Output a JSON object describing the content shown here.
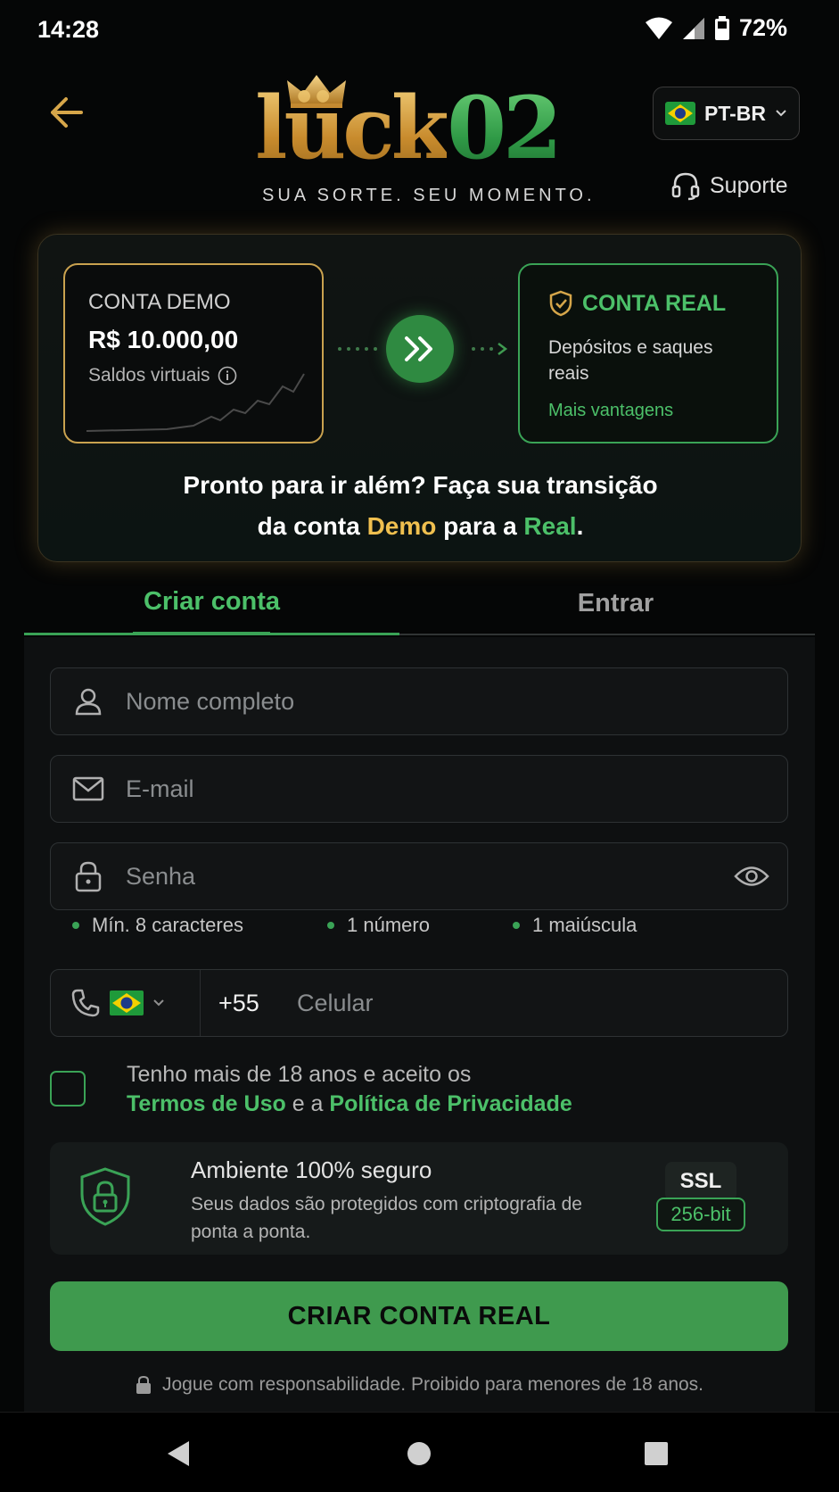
{
  "status_bar": {
    "time": "14:28",
    "battery": "72%"
  },
  "header": {
    "logo_luck": "lück",
    "logo_02": "02",
    "tagline": "SUA SORTE. SEU MOMENTO.",
    "language": "PT-BR",
    "support": "Suporte"
  },
  "promo": {
    "demo_title": "CONTA DEMO",
    "demo_amount": "R$ 10.000,00",
    "demo_sub": "Saldos virtuais",
    "real_title": "CONTA REAL",
    "real_desc": "Depósitos e saques reais",
    "real_link": "Mais vantagens",
    "text_line1": "Pronto para ir além? Faça sua transição",
    "text_prefix": "da conta ",
    "text_demo": "Demo",
    "text_mid": " para a ",
    "text_real": "Real",
    "text_end": ".",
    "colors": {
      "gold": "#f0c04f",
      "green": "#4cc069"
    }
  },
  "tabs": {
    "create": "Criar conta",
    "login": "Entrar"
  },
  "form": {
    "name_placeholder": "Nome completo",
    "email_placeholder": "E-mail",
    "password_placeholder": "Senha",
    "rules": [
      "Mín. 8 caracteres",
      "1 número",
      "1 maiúscula"
    ],
    "phone_prefix": "+55",
    "phone_placeholder": "Celular",
    "terms_prefix": "Tenho mais de 18 anos e aceito os",
    "terms_link": "Termos de Uso",
    "terms_mid": " e a ",
    "privacy_link": "Política de Privacidade",
    "secure_title": "Ambiente 100% seguro",
    "secure_desc": "Seus dados são protegidos com criptografia de ponta a ponta.",
    "ssl_top": "SSL",
    "ssl_bottom": "256-bit",
    "cta": "CRIAR CONTA REAL",
    "disclaimer": "Jogue com responsabilidade. Proibido para menores de 18 anos."
  },
  "icons": [
    "back-arrow-icon",
    "crown-icon",
    "brazil-flag-icon",
    "chevron-down-icon",
    "headset-icon",
    "info-icon",
    "double-chevron-right-icon",
    "shield-check-icon",
    "user-icon",
    "mail-icon",
    "lock-icon",
    "eye-icon",
    "phone-icon",
    "shield-lock-icon"
  ]
}
